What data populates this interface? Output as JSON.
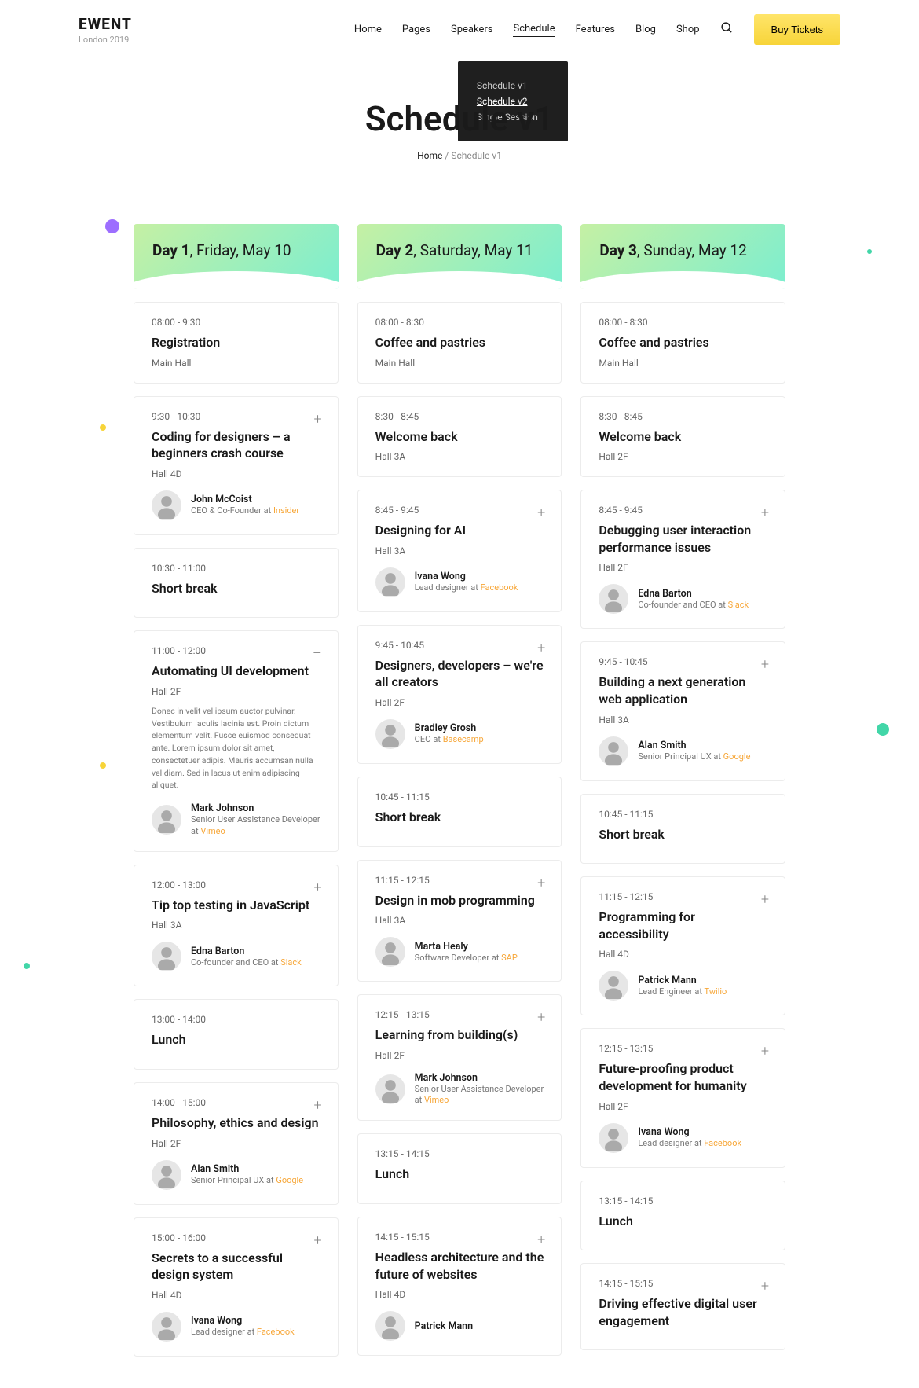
{
  "brand": {
    "name": "EWENT",
    "sub": "London 2019"
  },
  "nav": {
    "items": [
      "Home",
      "Pages",
      "Speakers",
      "Schedule",
      "Features",
      "Blog",
      "Shop"
    ],
    "active": "Schedule",
    "buy": "Buy Tickets"
  },
  "dropdown": {
    "items": [
      "Schedule v1",
      "Schedule v2",
      "Single Session"
    ],
    "active": "Schedule v2"
  },
  "hero": {
    "title": "Schedule v1",
    "crumb_home": "Home",
    "crumb_current": "Schedule v1"
  },
  "days": [
    {
      "bold": "Day 1",
      "date": ", Friday, May 10",
      "sessions": [
        {
          "time": "08:00 - 9:30",
          "title": "Registration",
          "loc": "Main Hall"
        },
        {
          "time": "9:30 - 10:30",
          "title": "Coding for designers – a beginners crash course",
          "loc": "Hall 4D",
          "expand": "+",
          "sp": {
            "name": "John McCoist",
            "role": "CEO & Co-Founder at ",
            "company": "Insider"
          }
        },
        {
          "time": "10:30 - 11:00",
          "title": "Short break",
          "loc": ""
        },
        {
          "time": "11:00 - 12:00",
          "title": "Automating UI development",
          "loc": "Hall 2F",
          "expand": "–",
          "desc": "Donec in velit vel ipsum auctor pulvinar. Vestibulum iaculis lacinia est. Proin dictum elementum velit. Fusce euismod consequat ante. Lorem ipsum dolor sit amet, consectetuer adipis. Mauris accumsan nulla vel diam. Sed in lacus ut enim adipiscing aliquet.",
          "sp": {
            "name": "Mark Johnson",
            "role": "Senior User Assistance Developer at ",
            "company": "Vimeo"
          }
        },
        {
          "time": "12:00 - 13:00",
          "title": "Tip top testing in JavaScript",
          "loc": "Hall 3A",
          "expand": "+",
          "sp": {
            "name": "Edna Barton",
            "role": "Co-founder and CEO at ",
            "company": "Slack"
          }
        },
        {
          "time": "13:00 - 14:00",
          "title": "Lunch",
          "loc": ""
        },
        {
          "time": "14:00 - 15:00",
          "title": "Philosophy, ethics and design",
          "loc": "Hall 2F",
          "expand": "+",
          "sp": {
            "name": "Alan Smith",
            "role": "Senior Principal UX at ",
            "company": "Google"
          }
        },
        {
          "time": "15:00 - 16:00",
          "title": "Secrets to a successful design system",
          "loc": "Hall 4D",
          "expand": "+",
          "sp": {
            "name": "Ivana Wong",
            "role": "Lead designer at ",
            "company": "Facebook"
          }
        }
      ]
    },
    {
      "bold": "Day 2",
      "date": ", Saturday, May 11",
      "sessions": [
        {
          "time": "08:00 - 8:30",
          "title": "Coffee and pastries",
          "loc": "Main Hall"
        },
        {
          "time": "8:30 - 8:45",
          "title": "Welcome back",
          "loc": "Hall 3A"
        },
        {
          "time": "8:45 - 9:45",
          "title": "Designing for AI",
          "loc": "Hall 3A",
          "expand": "+",
          "sp": {
            "name": "Ivana Wong",
            "role": "Lead designer at ",
            "company": "Facebook"
          }
        },
        {
          "time": "9:45 - 10:45",
          "title": "Designers, developers – we're all creators",
          "loc": "Hall 2F",
          "expand": "+",
          "sp": {
            "name": "Bradley Grosh",
            "role": "CEO at ",
            "company": "Basecamp"
          }
        },
        {
          "time": "10:45 - 11:15",
          "title": "Short break",
          "loc": ""
        },
        {
          "time": "11:15 - 12:15",
          "title": "Design in mob programming",
          "loc": "Hall 3A",
          "expand": "+",
          "sp": {
            "name": "Marta Healy",
            "role": "Software Developer at ",
            "company": "SAP"
          }
        },
        {
          "time": "12:15 - 13:15",
          "title": "Learning from building(s)",
          "loc": "Hall 2F",
          "expand": "+",
          "sp": {
            "name": "Mark Johnson",
            "role": "Senior User Assistance Developer at ",
            "company": "Vimeo"
          }
        },
        {
          "time": "13:15 - 14:15",
          "title": "Lunch",
          "loc": ""
        },
        {
          "time": "14:15 - 15:15",
          "title": "Headless architecture and the future of websites",
          "loc": "Hall 4D",
          "expand": "+",
          "sp": {
            "name": "Patrick Mann",
            "role": "",
            "company": ""
          }
        }
      ]
    },
    {
      "bold": "Day 3",
      "date": ", Sunday, May 12",
      "sessions": [
        {
          "time": "08:00 - 8:30",
          "title": "Coffee and pastries",
          "loc": "Main Hall"
        },
        {
          "time": "8:30 - 8:45",
          "title": "Welcome back",
          "loc": "Hall 2F"
        },
        {
          "time": "8:45 - 9:45",
          "title": "Debugging user interaction performance issues",
          "loc": "Hall 2F",
          "expand": "+",
          "sp": {
            "name": "Edna Barton",
            "role": "Co-founder and CEO at ",
            "company": "Slack"
          }
        },
        {
          "time": "9:45 - 10:45",
          "title": "Building a next generation web application",
          "loc": "Hall 3A",
          "expand": "+",
          "sp": {
            "name": "Alan Smith",
            "role": "Senior Principal UX at ",
            "company": "Google"
          }
        },
        {
          "time": "10:45 - 11:15",
          "title": "Short break",
          "loc": ""
        },
        {
          "time": "11:15 - 12:15",
          "title": "Programming for accessibility",
          "loc": "Hall 4D",
          "expand": "+",
          "sp": {
            "name": "Patrick Mann",
            "role": "Lead Engineer at ",
            "company": "Twilio"
          }
        },
        {
          "time": "12:15 - 13:15",
          "title": "Future-proofing product development for humanity",
          "loc": "Hall 2F",
          "expand": "+",
          "sp": {
            "name": "Ivana Wong",
            "role": "Lead designer at ",
            "company": "Facebook"
          }
        },
        {
          "time": "13:15 - 14:15",
          "title": "Lunch",
          "loc": ""
        },
        {
          "time": "14:15 - 15:15",
          "title": "Driving effective digital user engagement",
          "loc": "",
          "expand": "+"
        }
      ]
    }
  ]
}
